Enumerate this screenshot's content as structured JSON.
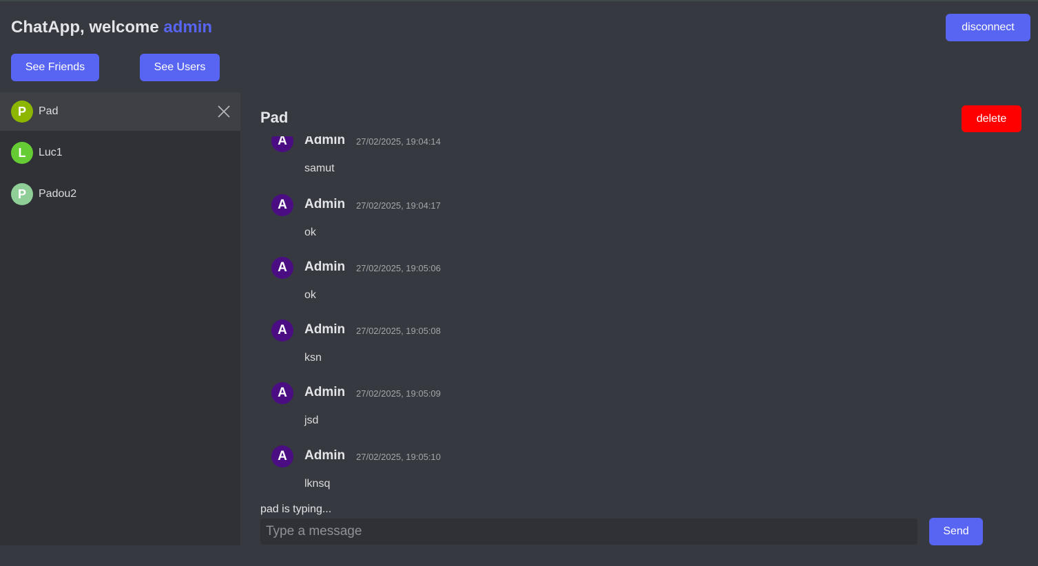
{
  "header": {
    "title_prefix": "ChatApp, welcome ",
    "username": "admin",
    "disconnect_label": "disconnect",
    "see_friends_label": "See Friends",
    "see_users_label": "See Users"
  },
  "colors": {
    "accent": "#5865f2",
    "danger": "#ff0000",
    "message_avatar": "#4b0e82"
  },
  "sidebar": {
    "contacts": [
      {
        "initial": "P",
        "name": "Pad",
        "color": "#8db600",
        "active": true
      },
      {
        "initial": "L",
        "name": "Luc1",
        "color": "#66cc33",
        "active": false
      },
      {
        "initial": "P",
        "name": "Padou2",
        "color": "#8fce96",
        "active": false
      }
    ]
  },
  "chat": {
    "title": "Pad",
    "delete_label": "delete",
    "messages": [
      {
        "initial": "A",
        "author": "Admin",
        "time": "27/02/2025, 19:04:14",
        "text": "samut"
      },
      {
        "initial": "A",
        "author": "Admin",
        "time": "27/02/2025, 19:04:17",
        "text": "ok"
      },
      {
        "initial": "A",
        "author": "Admin",
        "time": "27/02/2025, 19:05:06",
        "text": "ok"
      },
      {
        "initial": "A",
        "author": "Admin",
        "time": "27/02/2025, 19:05:08",
        "text": "ksn"
      },
      {
        "initial": "A",
        "author": "Admin",
        "time": "27/02/2025, 19:05:09",
        "text": "jsd"
      },
      {
        "initial": "A",
        "author": "Admin",
        "time": "27/02/2025, 19:05:10",
        "text": "lknsq"
      }
    ],
    "typing_text": "pad is typing...",
    "input_placeholder": "Type a message",
    "send_label": "Send"
  }
}
